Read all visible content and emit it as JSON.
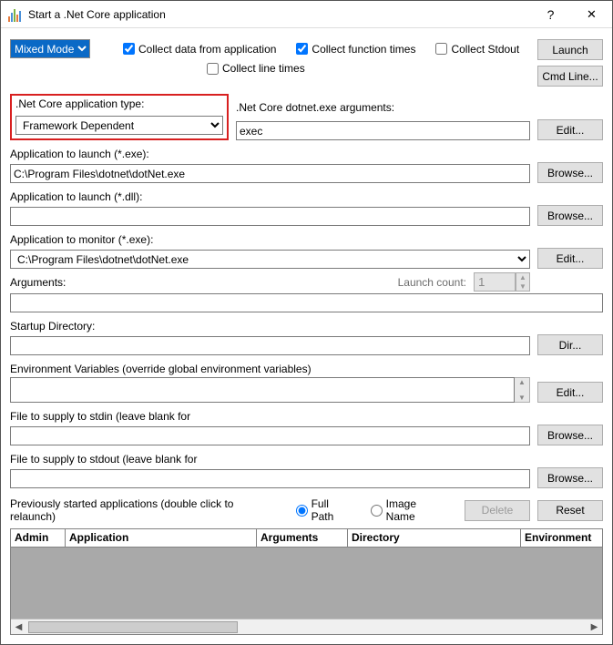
{
  "window": {
    "title": "Start a .Net Core application"
  },
  "mode": {
    "selected": "Mixed Mode"
  },
  "checks": {
    "collect_data": "Collect data from application",
    "collect_func": "Collect function times",
    "collect_stdout": "Collect Stdout",
    "collect_line": "Collect line times"
  },
  "buttons": {
    "launch": "Launch",
    "cmdline": "Cmd Line...",
    "edit": "Edit...",
    "browse": "Browse...",
    "dir": "Dir...",
    "delete": "Delete",
    "reset": "Reset"
  },
  "labels": {
    "app_type": ".Net Core application type:",
    "dotnet_args": ".Net Core dotnet.exe arguments:",
    "app_launch_exe": "Application to launch (*.exe):",
    "app_launch_dll": "Application to launch (*.dll):",
    "app_monitor": "Application to monitor (*.exe):",
    "arguments": "Arguments:",
    "launch_count": "Launch count:",
    "startup_dir": "Startup Directory:",
    "env_vars": "Environment Variables (override global environment variables)",
    "stdin": "File to supply to stdin (leave blank for",
    "stdout": "File to supply to stdout (leave blank for",
    "prev_apps": "Previously started applications (double click to relaunch)",
    "full_path": "Full Path",
    "image_name": "Image Name"
  },
  "values": {
    "app_type": "Framework Dependent",
    "dotnet_args": "exec",
    "app_launch_exe": "C:\\Program Files\\dotnet\\dotNet.exe",
    "app_launch_dll": "",
    "app_monitor": "C:\\Program Files\\dotnet\\dotNet.exe",
    "arguments": "",
    "launch_count": "1",
    "startup_dir": "",
    "env_vars": "",
    "stdin": "",
    "stdout": ""
  },
  "table": {
    "cols": [
      "Admin",
      "Application",
      "Arguments",
      "Directory",
      "Environment"
    ]
  }
}
